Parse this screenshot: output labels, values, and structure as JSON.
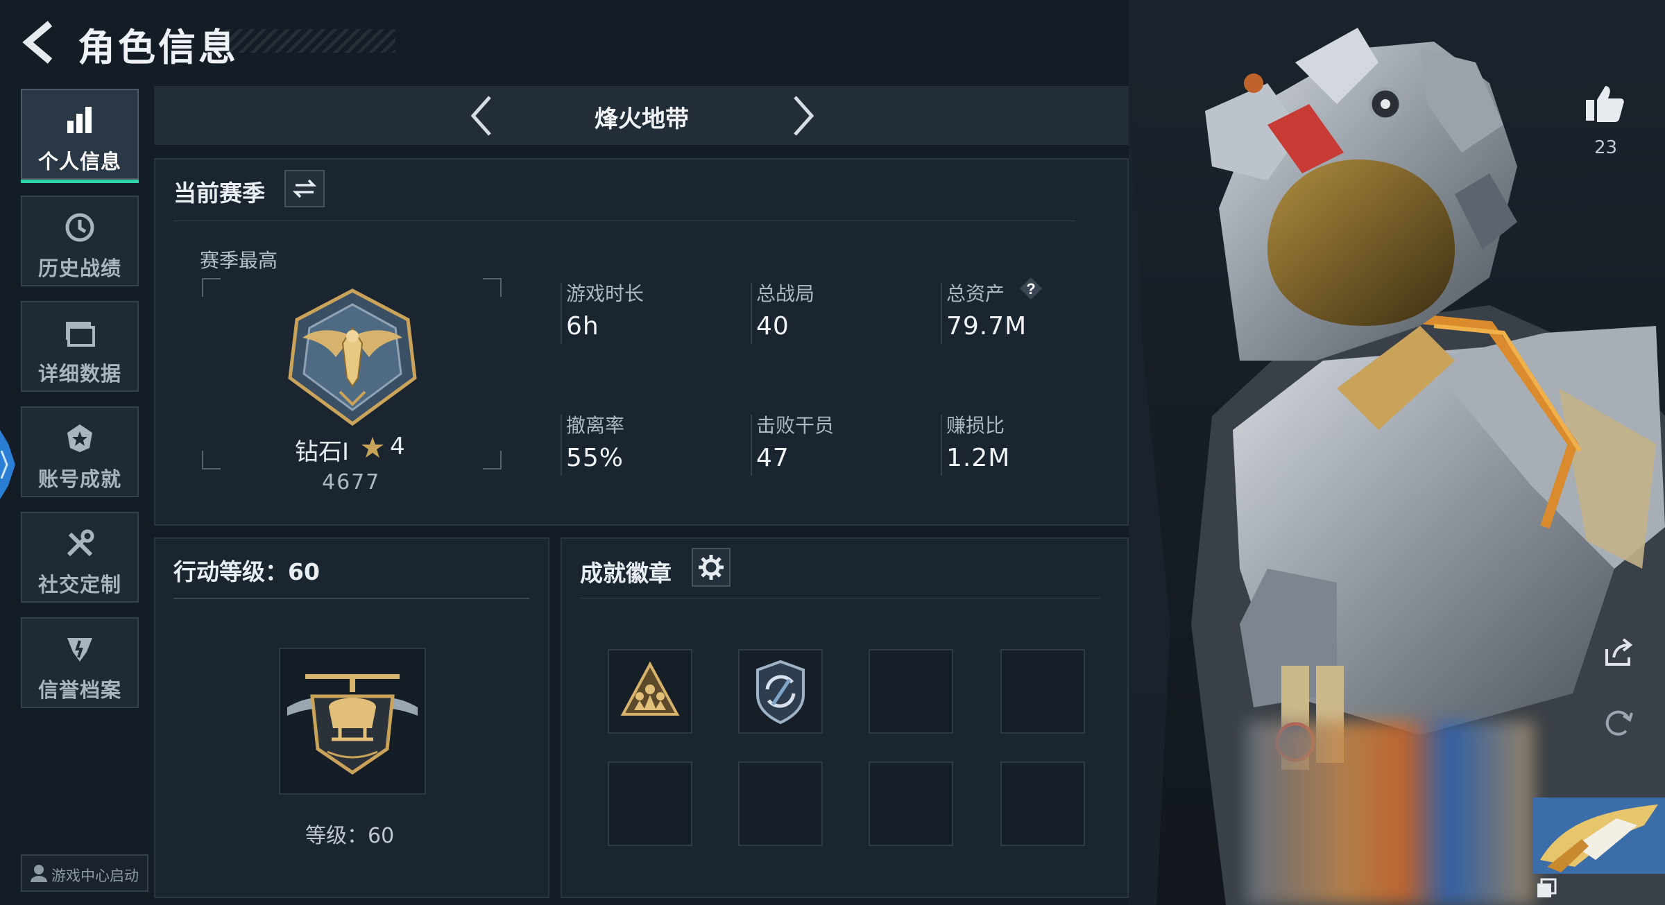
{
  "header": {
    "title": "角色信息"
  },
  "sidebar": {
    "items": [
      {
        "label": "个人信息",
        "icon": "bar-chart-icon",
        "active": true
      },
      {
        "label": "历史战绩",
        "icon": "history-clock-icon",
        "active": false
      },
      {
        "label": "详细数据",
        "icon": "folder-icon",
        "active": false
      },
      {
        "label": "账号成就",
        "icon": "achievement-star-icon",
        "active": false
      },
      {
        "label": "社交定制",
        "icon": "tools-icon",
        "active": false
      },
      {
        "label": "信誉档案",
        "icon": "credit-shield-icon",
        "active": false
      }
    ],
    "game_center_label": "游戏中心启动"
  },
  "mode_selector": {
    "current": "烽火地带"
  },
  "season": {
    "title": "当前赛季",
    "best_label": "赛季最高",
    "rank": {
      "name": "钻石Ⅰ",
      "stars": "4",
      "score": "4677"
    },
    "stats": [
      {
        "label": "游戏时长",
        "value": "6h"
      },
      {
        "label": "总战局",
        "value": "40"
      },
      {
        "label": "总资产",
        "value": "79.7M",
        "has_help": true
      },
      {
        "label": "撤离率",
        "value": "55%"
      },
      {
        "label": "击败干员",
        "value": "47"
      },
      {
        "label": "赚损比",
        "value": "1.2M"
      }
    ],
    "help_glyph": "?"
  },
  "action_level": {
    "title": "行动等级：60",
    "level_text": "等级：60"
  },
  "achievements": {
    "title": "成就徽章",
    "badges": [
      "squad-triangle-badge",
      "shield-rotate-badge",
      "",
      "",
      "",
      "",
      "",
      ""
    ]
  },
  "social": {
    "likes": "23"
  },
  "colors": {
    "accent": "#2fd1a8",
    "gold": "#c9a35a",
    "panel": "#1b252f",
    "background": "#141c25"
  }
}
